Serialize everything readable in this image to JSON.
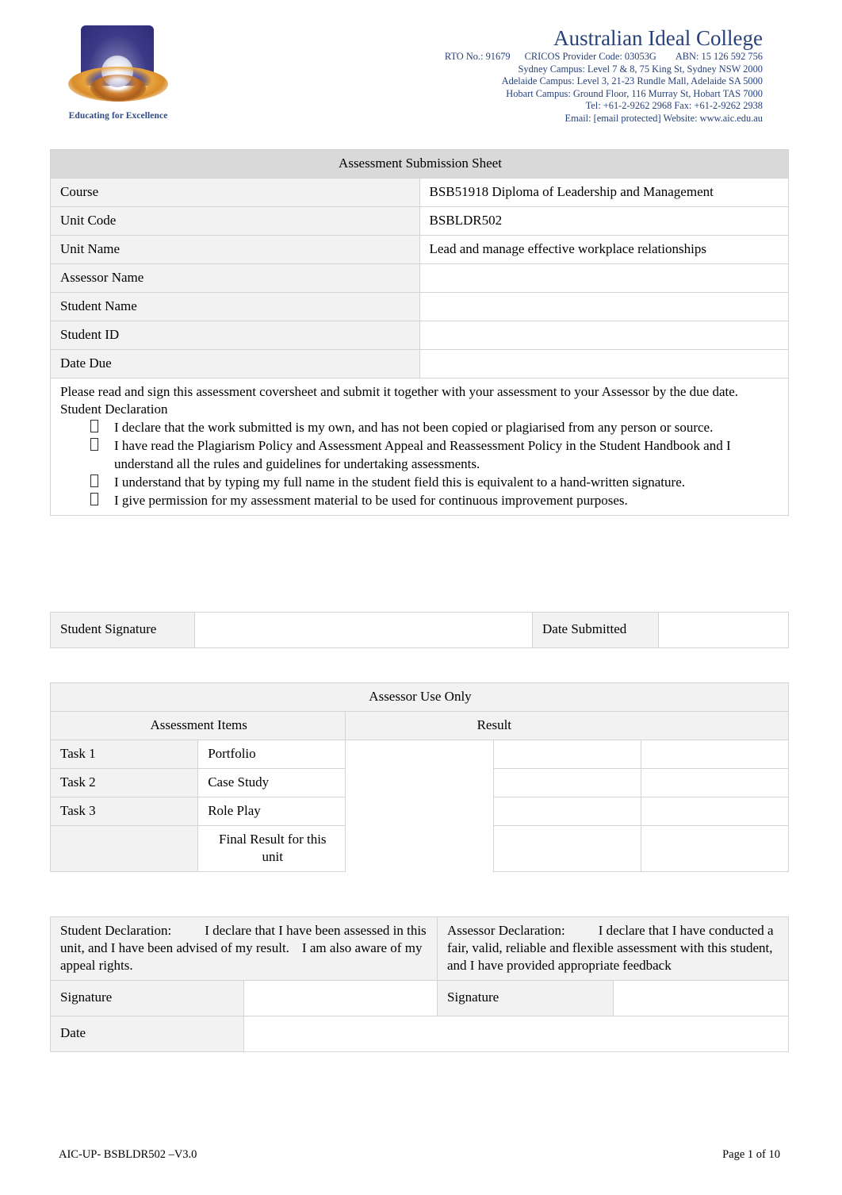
{
  "header": {
    "logo_tagline": "Educating for Excellence",
    "college_name": "Australian Ideal College",
    "rto": "RTO No.: 91679",
    "cricos": "CRICOS Provider Code: 03053G",
    "abn": "ABN: 15 126 592 756",
    "campus_sydney": "Sydney Campus: Level 7 & 8, 75 King St, Sydney NSW 2000",
    "campus_adelaide": "Adelaide Campus: Level 3, 21-23 Rundle Mall, Adelaide SA 5000",
    "campus_hobart": "Hobart Campus: Ground Floor, 116 Murray St, Hobart TAS 7000",
    "phone": "Tel: +61-2-9262 2968 Fax: +61-2-9262 2938",
    "email_web": "Email: [email protected] Website: www.aic.edu.au"
  },
  "main_table": {
    "title": "Assessment Submission Sheet",
    "rows": [
      {
        "label": "Course",
        "value": "BSB51918 Diploma of Leadership and Management"
      },
      {
        "label": "Unit Code",
        "value": "BSBLDR502"
      },
      {
        "label": "Unit Name",
        "value": "Lead and manage effective workplace relationships"
      },
      {
        "label": "Assessor Name",
        "value": ""
      },
      {
        "label": "Student Name",
        "value": ""
      },
      {
        "label": "Student ID",
        "value": ""
      },
      {
        "label": "Date Due",
        "value": ""
      }
    ],
    "instruction": "Please read and sign this assessment coversheet and submit it together with your assessment to your Assessor by the due date.",
    "declaration_heading": "Student Declaration",
    "declaration_items": [
      "I declare that the work submitted is my own, and has not been copied or plagiarised from any person or source.",
      "I have read the Plagiarism Policy and Assessment Appeal and Reassessment Policy in the Student Handbook and I understand all the rules and guidelines for undertaking assessments.",
      "I understand that by typing my full name in the student field this is equivalent to a hand-written signature.",
      "I give permission for my assessment material to be used for continuous improvement purposes."
    ],
    "student_signature_label": "Student Signature",
    "student_signature_value": "",
    "date_submitted_label": "Date Submitted",
    "date_submitted_value": ""
  },
  "assessor_table": {
    "title": "Assessor Use Only",
    "col_items": "Assessment Items",
    "col_result": "Result",
    "tasks": [
      {
        "task": "Task 1",
        "item": "Portfolio",
        "result_a": "",
        "result_b": ""
      },
      {
        "task": "Task 2",
        "item": "Case Study",
        "result_a": "",
        "result_b": ""
      },
      {
        "task": "Task 3",
        "item": "Role Play",
        "result_a": "",
        "result_b": ""
      }
    ],
    "final_label": "Final Result for this unit",
    "final_result_a": "",
    "final_result_b": ""
  },
  "final_table": {
    "student_declaration_label": "Student Declaration:",
    "student_declaration_text": "I declare that I have been assessed in this unit, and I have been advised of my result.",
    "student_declaration_text2": "I am also aware of my appeal rights.",
    "assessor_declaration_label": "Assessor Declaration:",
    "assessor_declaration_text": "I declare that I have conducted a fair, valid, reliable and flexible assessment with this student, and I have provided appropriate feedback",
    "student_signature_label": "Signature",
    "student_signature_value": "",
    "assessor_signature_label": "Signature",
    "assessor_signature_value": "",
    "date_label": "Date",
    "date_value": ""
  },
  "footer": {
    "doc_code": "AIC-UP- BSBLDR502 –V3.0",
    "page": "Page 1 of 10"
  },
  "colors": {
    "brand_blue": "#27417a",
    "title_bar": "#d9d9d9",
    "shade": "#f2f2f2",
    "border": "#d4d4d4"
  }
}
